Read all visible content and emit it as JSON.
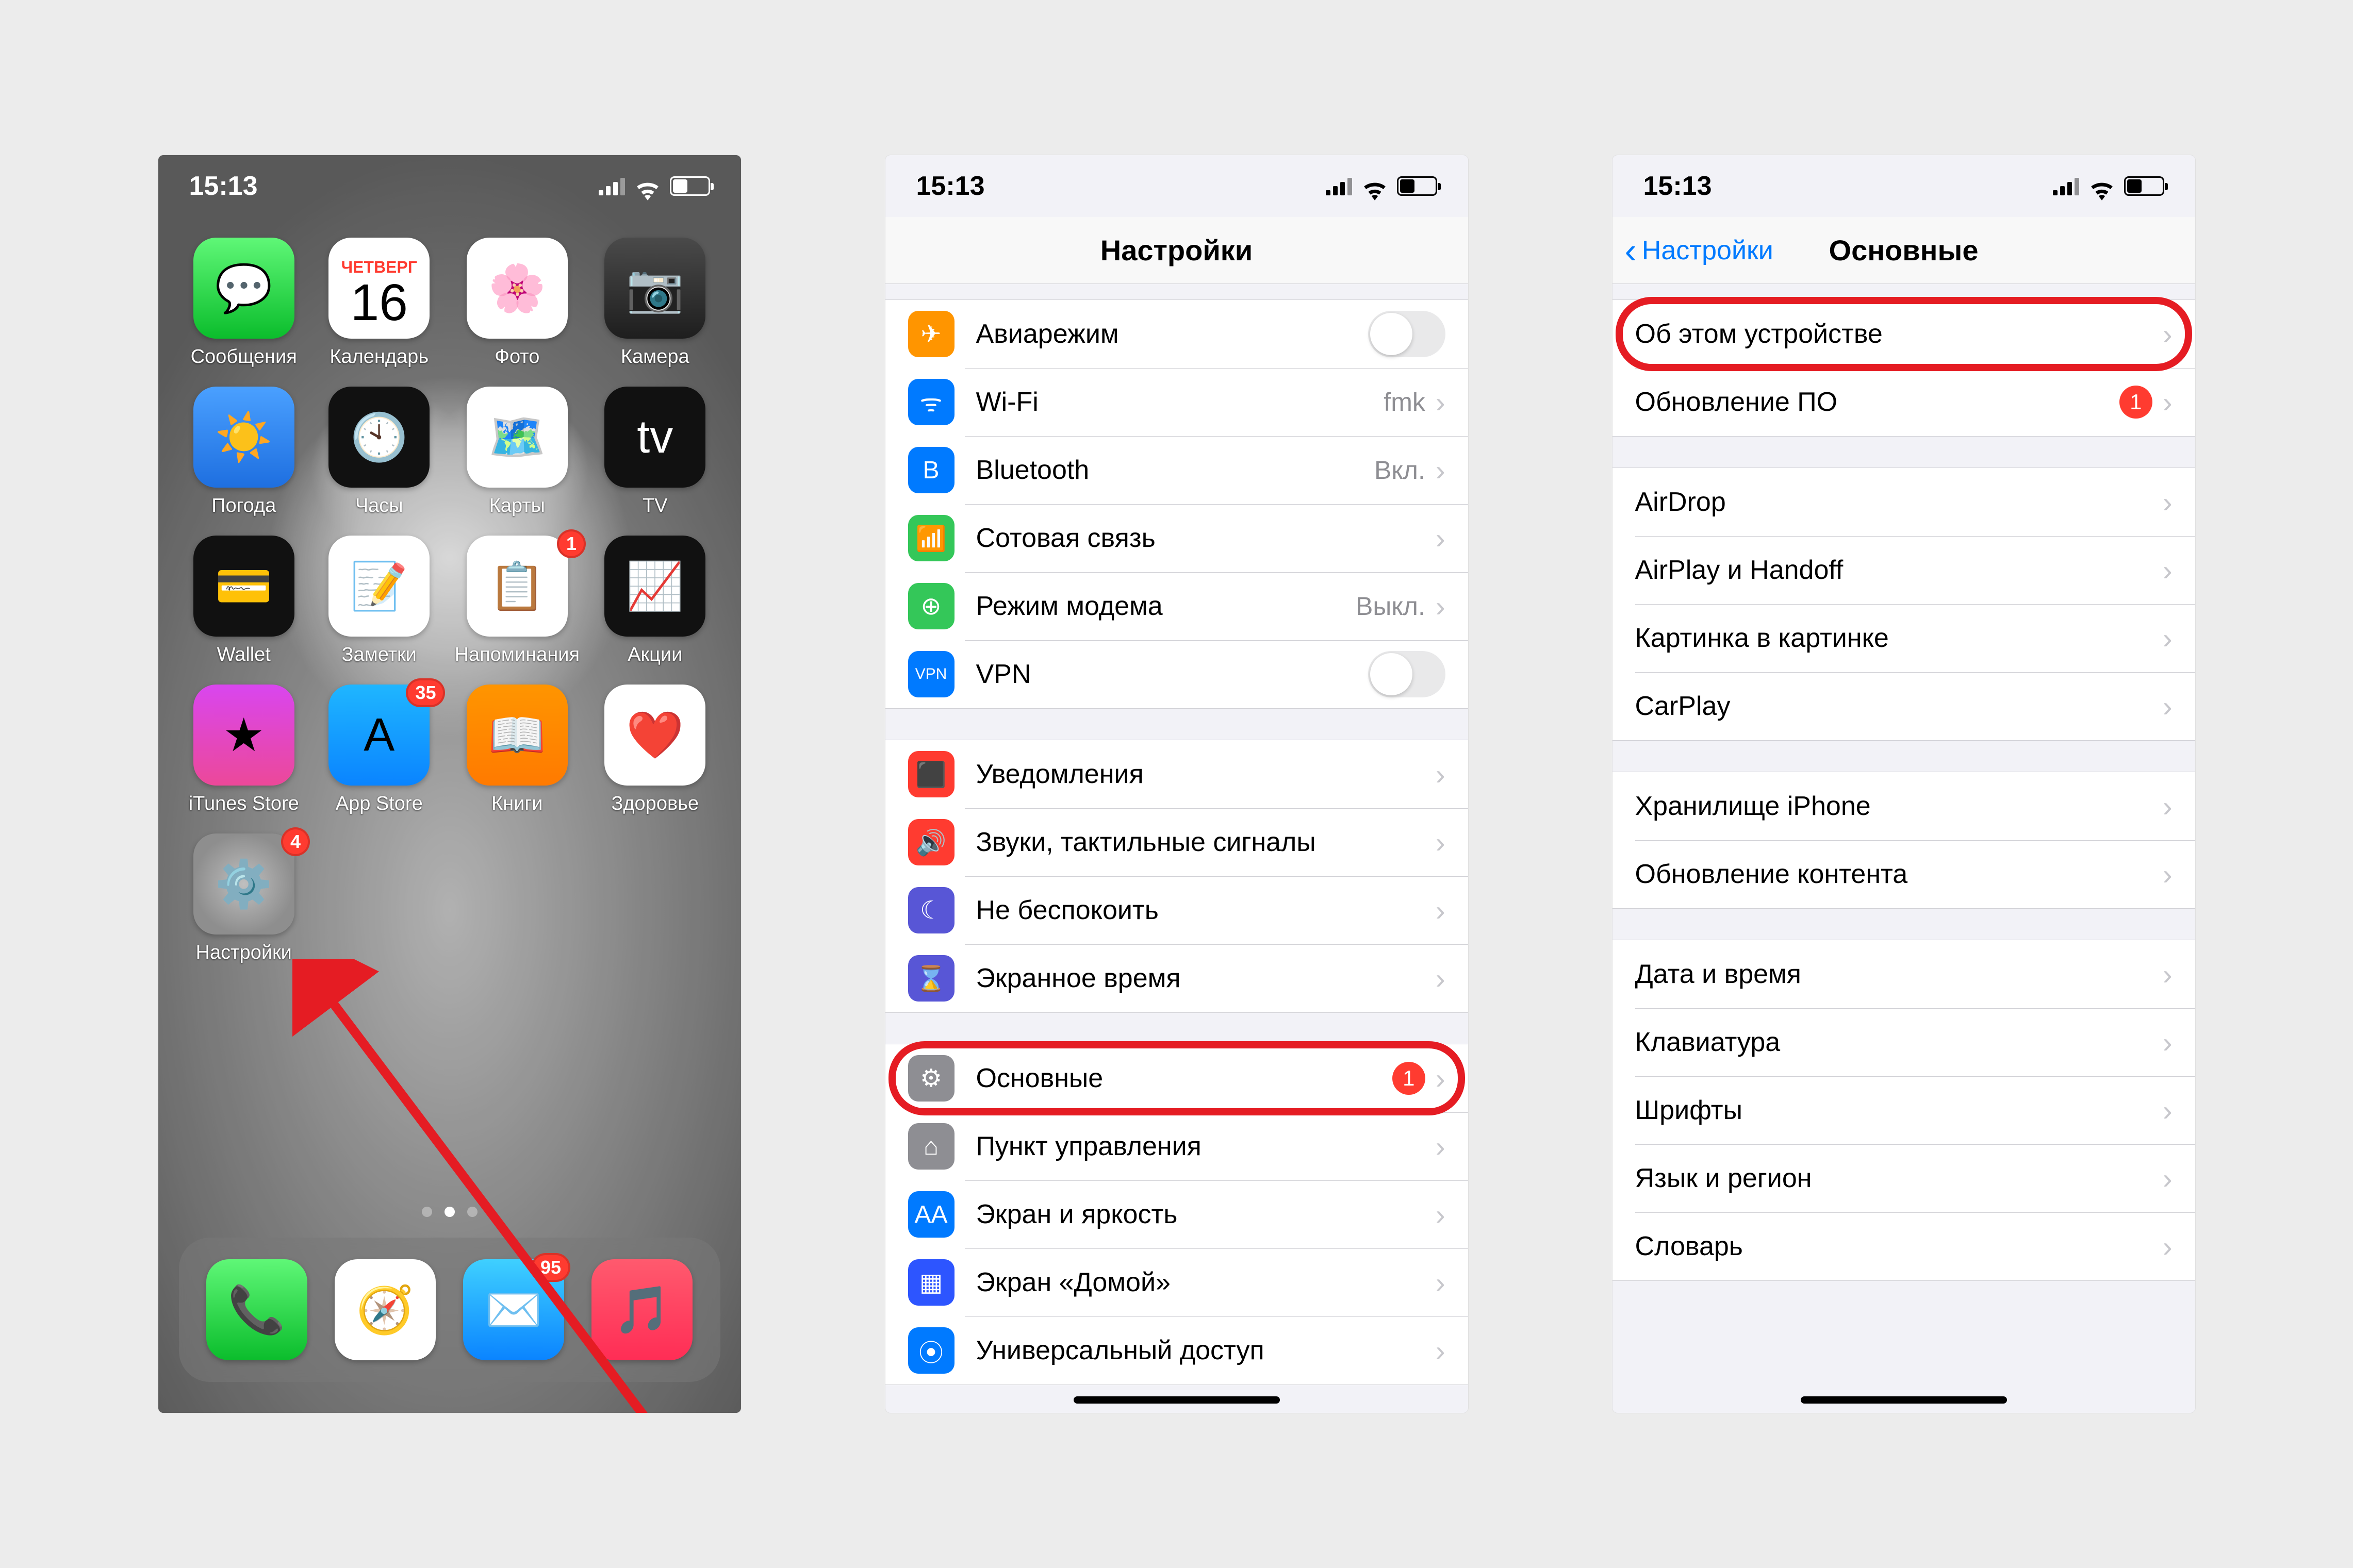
{
  "status": {
    "time": "15:13"
  },
  "home": {
    "calendar": {
      "weekday": "Четверг",
      "day": "16"
    },
    "apps": [
      {
        "key": "messages",
        "label": "Сообщения",
        "cls": "i-messages",
        "glyph": "💬"
      },
      {
        "key": "calendar",
        "label": "Календарь",
        "cls": "i-calendar"
      },
      {
        "key": "photos",
        "label": "Фото",
        "cls": "i-photos",
        "glyph": "🌸"
      },
      {
        "key": "camera",
        "label": "Камера",
        "cls": "i-camera",
        "glyph": "📷"
      },
      {
        "key": "weather",
        "label": "Погода",
        "cls": "i-weather",
        "glyph": "☀️"
      },
      {
        "key": "clock",
        "label": "Часы",
        "cls": "i-clock",
        "glyph": "🕙"
      },
      {
        "key": "maps",
        "label": "Карты",
        "cls": "i-maps",
        "glyph": "🗺️"
      },
      {
        "key": "tv",
        "label": "TV",
        "cls": "i-tv",
        "glyph": "tv"
      },
      {
        "key": "wallet",
        "label": "Wallet",
        "cls": "i-wallet",
        "glyph": "💳"
      },
      {
        "key": "notes",
        "label": "Заметки",
        "cls": "i-notes",
        "glyph": "📝"
      },
      {
        "key": "reminders",
        "label": "Напоминания",
        "cls": "i-reminders",
        "glyph": "📋",
        "badge": "1"
      },
      {
        "key": "stocks",
        "label": "Акции",
        "cls": "i-stocks",
        "glyph": "📈"
      },
      {
        "key": "itunes",
        "label": "iTunes Store",
        "cls": "i-itunes",
        "glyph": "★"
      },
      {
        "key": "appstore",
        "label": "App Store",
        "cls": "i-appstore",
        "glyph": "A",
        "badge": "35"
      },
      {
        "key": "books",
        "label": "Книги",
        "cls": "i-books",
        "glyph": "📖"
      },
      {
        "key": "health",
        "label": "Здоровье",
        "cls": "i-health",
        "glyph": "❤️"
      },
      {
        "key": "settings",
        "label": "Настройки",
        "cls": "i-settings",
        "glyph": "⚙️",
        "badge": "4"
      }
    ],
    "dock": [
      {
        "key": "phone",
        "cls": "i-phone",
        "glyph": "📞"
      },
      {
        "key": "safari",
        "cls": "i-safari",
        "glyph": "🧭"
      },
      {
        "key": "mail",
        "cls": "i-mail",
        "glyph": "✉️",
        "badge": "95"
      },
      {
        "key": "music",
        "cls": "i-music",
        "glyph": "🎵"
      }
    ]
  },
  "settings": {
    "title": "Настройки",
    "groups": [
      [
        {
          "key": "airplane",
          "icon": "c-orange",
          "glyph": "✈︎",
          "label": "Авиарежим",
          "accessory": "switch"
        },
        {
          "key": "wifi",
          "icon": "c-blue",
          "glyph": "ᯤ",
          "label": "Wi-Fi",
          "value": "fmk",
          "accessory": "chevron"
        },
        {
          "key": "bluetooth",
          "icon": "c-blue",
          "glyph": "B",
          "label": "Bluetooth",
          "value": "Вкл.",
          "accessory": "chevron"
        },
        {
          "key": "cellular",
          "icon": "c-green",
          "glyph": "📶",
          "label": "Сотовая связь",
          "accessory": "chevron"
        },
        {
          "key": "hotspot",
          "icon": "c-green",
          "glyph": "⊕",
          "label": "Режим модема",
          "value": "Выкл.",
          "accessory": "chevron"
        },
        {
          "key": "vpn",
          "icon": "c-blue",
          "glyph": "VPN",
          "label": "VPN",
          "accessory": "switch"
        }
      ],
      [
        {
          "key": "notifications",
          "icon": "c-red",
          "glyph": "⬛",
          "label": "Уведомления",
          "accessory": "chevron"
        },
        {
          "key": "sounds",
          "icon": "c-red",
          "glyph": "🔊",
          "label": "Звуки, тактильные сигналы",
          "accessory": "chevron"
        },
        {
          "key": "dnd",
          "icon": "c-purple",
          "glyph": "☾",
          "label": "Не беспокоить",
          "accessory": "chevron"
        },
        {
          "key": "screentime",
          "icon": "c-purple",
          "glyph": "⌛",
          "label": "Экранное время",
          "accessory": "chevron"
        }
      ],
      [
        {
          "key": "general",
          "icon": "c-grey",
          "glyph": "⚙︎",
          "label": "Основные",
          "badge": "1",
          "accessory": "chevron",
          "highlight": true
        },
        {
          "key": "control-center",
          "icon": "c-grey",
          "glyph": "⌂",
          "label": "Пункт управления",
          "accessory": "chevron"
        },
        {
          "key": "display",
          "icon": "c-blue",
          "glyph": "AA",
          "label": "Экран и яркость",
          "accessory": "chevron"
        },
        {
          "key": "homescreen",
          "icon": "c-dkblue",
          "glyph": "▦",
          "label": "Экран «Домой»",
          "accessory": "chevron"
        },
        {
          "key": "accessibility",
          "icon": "c-blue",
          "glyph": "⦿",
          "label": "Универсальный доступ",
          "accessory": "chevron"
        }
      ]
    ]
  },
  "general": {
    "back": "Настройки",
    "title": "Основные",
    "groups": [
      [
        {
          "key": "about",
          "label": "Об этом устройстве",
          "accessory": "chevron",
          "highlight": true
        },
        {
          "key": "swupdate",
          "label": "Обновление ПО",
          "badge": "1",
          "accessory": "chevron"
        }
      ],
      [
        {
          "key": "airdrop",
          "label": "AirDrop",
          "accessory": "chevron"
        },
        {
          "key": "airplay",
          "label": "AirPlay и Handoff",
          "accessory": "chevron"
        },
        {
          "key": "pip",
          "label": "Картинка в картинке",
          "accessory": "chevron"
        },
        {
          "key": "carplay",
          "label": "CarPlay",
          "accessory": "chevron"
        }
      ],
      [
        {
          "key": "storage",
          "label": "Хранилище iPhone",
          "accessory": "chevron"
        },
        {
          "key": "bgapp",
          "label": "Обновление контента",
          "accessory": "chevron"
        }
      ],
      [
        {
          "key": "date",
          "label": "Дата и время",
          "accessory": "chevron"
        },
        {
          "key": "keyboard",
          "label": "Клавиатура",
          "accessory": "chevron"
        },
        {
          "key": "fonts",
          "label": "Шрифты",
          "accessory": "chevron"
        },
        {
          "key": "lang",
          "label": "Язык и регион",
          "accessory": "chevron"
        },
        {
          "key": "dict",
          "label": "Словарь",
          "accessory": "chevron"
        }
      ]
    ]
  }
}
